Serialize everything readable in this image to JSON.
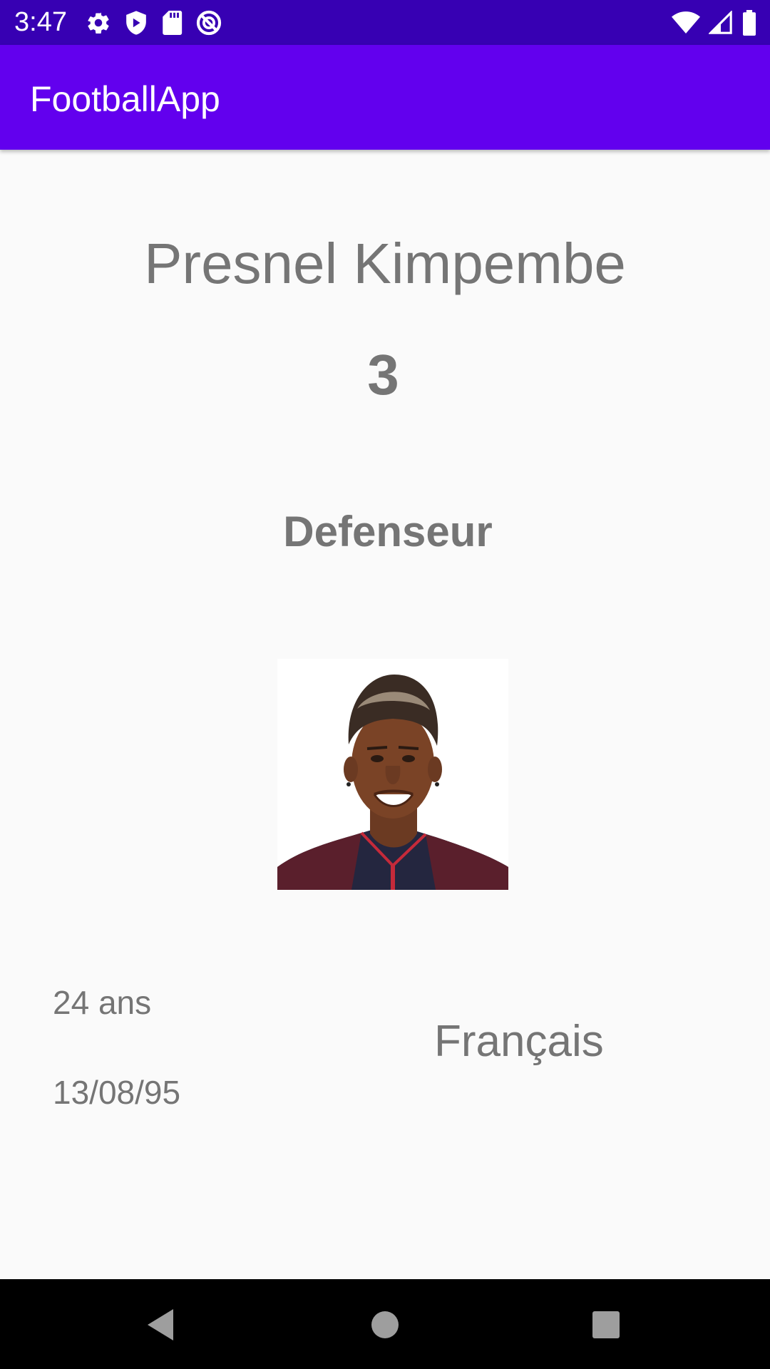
{
  "status_bar": {
    "time": "3:47",
    "background_color": "#3700b3",
    "left_icons": [
      "gear-icon",
      "play-protect-icon",
      "sd-card-icon",
      "no-disturb-icon"
    ],
    "right_icons": [
      "wifi-icon",
      "cellular-signal-icon",
      "battery-icon"
    ]
  },
  "app_bar": {
    "title": "FootballApp",
    "background_color": "#6200ee"
  },
  "player": {
    "name": "Presnel Kimpembe",
    "number": "3",
    "position": "Defenseur",
    "age": "24 ans",
    "birthdate": "13/08/95",
    "nationality": "Français"
  },
  "navigation_bar": {
    "buttons": [
      "back-icon",
      "home-icon",
      "recents-icon"
    ]
  }
}
